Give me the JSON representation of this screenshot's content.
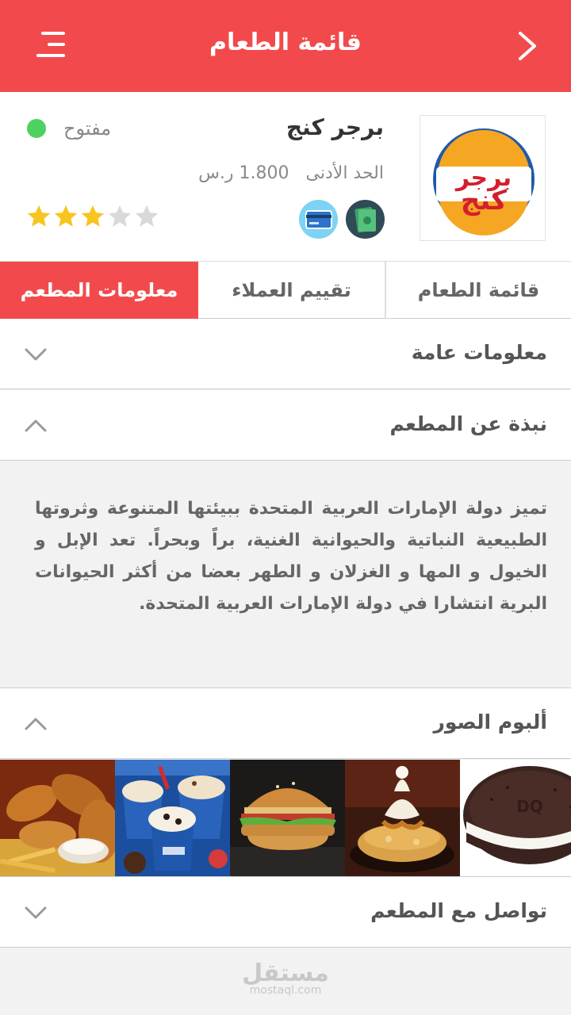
{
  "topbar": {
    "title": "قائمة الطعام"
  },
  "restaurant": {
    "name": "برجر كنج",
    "min_order_label": "الحد الأدنى",
    "min_order_value": "1.800 ر.س",
    "status": "مفتوح",
    "status_color": "#4fd15f",
    "rating": 3,
    "rating_max": 5,
    "logo_text_top": "برجر",
    "logo_text_bottom": "كنج",
    "payment_icons": [
      "credit-card-icon",
      "cash-icon"
    ]
  },
  "tabs": [
    {
      "label": "قائمة الطعام",
      "active": false
    },
    {
      "label": "تقييم العملاء",
      "active": false
    },
    {
      "label": "معلومات المطعم",
      "active": true
    }
  ],
  "sections": {
    "general": {
      "label": "معلومات عامة",
      "expanded": false
    },
    "about": {
      "label": "نبذة عن المطعم",
      "expanded": true,
      "body": "تميز دولة الإمارات العربية المتحدة ببيئتها المتنوعة وثروتها الطبيعية النباتية والحيوانية الغنية، براً وبحراً. تعد الإبل و الخيول و المها و الغزلان و الطهر بعضا من أكثر الحيوانات البرية انتشارا في دولة الإمارات العربية المتحدة."
    },
    "album": {
      "label": "ألبوم الصور",
      "expanded": true
    },
    "contact": {
      "label": "تواصل مع المطعم",
      "expanded": false
    }
  },
  "photos": [
    "chicken-tenders-photo",
    "blizzard-cups-photo",
    "chicken-sandwich-photo",
    "sundae-photo",
    "ice-cream-sandwich-photo"
  ],
  "watermark": {
    "line1": "مستقل",
    "line2": "mostaql.com"
  },
  "colors": {
    "accent": "#f24a4c",
    "star": "#f7c51e",
    "star_empty": "#d9d9d9"
  }
}
